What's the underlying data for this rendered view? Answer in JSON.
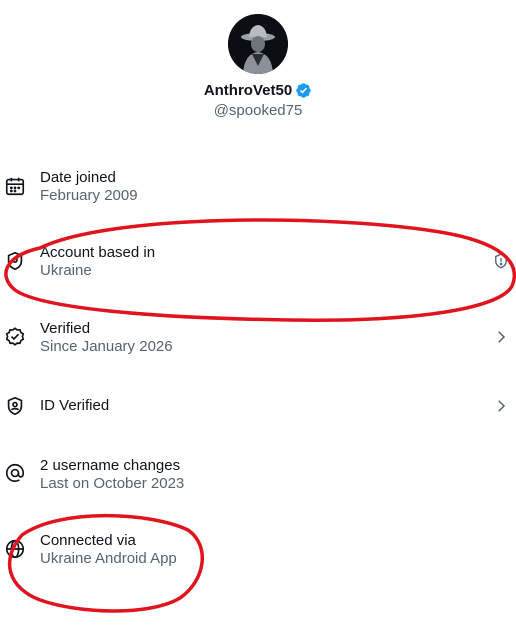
{
  "profile": {
    "display_name": "AnthroVet50",
    "handle": "@spooked75",
    "verified_color": "#1d9bf0"
  },
  "rows": [
    {
      "icon": "calendar-icon",
      "title": "Date joined",
      "subtitle": "February 2009"
    },
    {
      "icon": "location-shield-icon",
      "title": "Account based in",
      "subtitle": "Ukraine",
      "right_icon": "shield-info-icon"
    },
    {
      "icon": "verified-badge-outline-icon",
      "title": "Verified",
      "subtitle": "Since January 2026",
      "right_icon": "chevron-right-icon"
    },
    {
      "icon": "id-shield-icon",
      "title": "ID Verified",
      "right_icon": "chevron-right-icon"
    },
    {
      "icon": "at-sign-icon",
      "title": "2 username changes",
      "subtitle": "Last on October 2023"
    },
    {
      "icon": "globe-icon",
      "title": "Connected via",
      "subtitle": "Ukraine Android App"
    }
  ],
  "annotation_color": "#e0141e"
}
